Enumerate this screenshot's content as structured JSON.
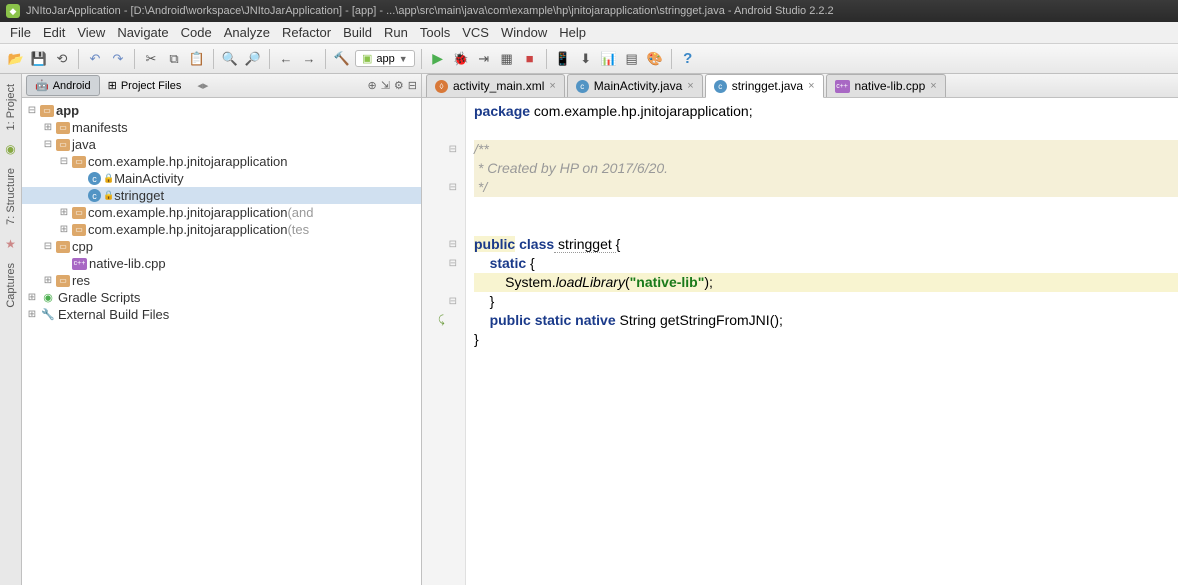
{
  "title": "JNItoJarApplication - [D:\\Android\\workspace\\JNItoJarApplication] - [app] - ...\\app\\src\\main\\java\\com\\example\\hp\\jnitojarapplication\\stringget.java - Android Studio 2.2.2",
  "menu": [
    "File",
    "Edit",
    "View",
    "Navigate",
    "Code",
    "Analyze",
    "Refactor",
    "Build",
    "Run",
    "Tools",
    "VCS",
    "Window",
    "Help"
  ],
  "run_target": "app",
  "panel": {
    "tab_android": "Android",
    "tab_files": "Project Files"
  },
  "gutter": {
    "project": "1: Project",
    "structure": "7: Structure",
    "captures": "Captures"
  },
  "tree": {
    "app": "app",
    "manifests": "manifests",
    "java": "java",
    "pkg": "com.example.hp.jnitojarapplication",
    "main_activity": "MainActivity",
    "stringget": "stringget",
    "pkg_and": "com.example.hp.jnitojarapplication",
    "pkg_and_suffix": " (and",
    "pkg_test": "com.example.hp.jnitojarapplication",
    "pkg_test_suffix": " (tes",
    "cpp": "cpp",
    "native_lib": "native-lib.cpp",
    "res": "res",
    "gradle": "Gradle Scripts",
    "external": "External Build Files"
  },
  "tabs": [
    {
      "icon": "xml",
      "label": "activity_main.xml"
    },
    {
      "icon": "java",
      "label": "MainActivity.java"
    },
    {
      "icon": "java",
      "label": "stringget.java",
      "active": true
    },
    {
      "icon": "cpp",
      "label": "native-lib.cpp"
    }
  ],
  "code": {
    "package_kw": "package",
    "package_name": " com.example.hp.jnitojarapplication;",
    "comment1": "/**",
    "comment2": " * Created by HP on 2017/6/20.",
    "comment3": " */",
    "public": "public",
    "class": "class",
    "classname": " stringget ",
    "brace_o": "{",
    "static": "static",
    "sys": "        System.",
    "loadlib": "loadLibrary",
    "paren_o": "(",
    "lib_str": "\"native-lib\"",
    "paren_c": ");",
    "brace_c": "}",
    "native": "native",
    "ret": " String ",
    "method": "getStringFromJNI",
    "method_end": "();"
  }
}
